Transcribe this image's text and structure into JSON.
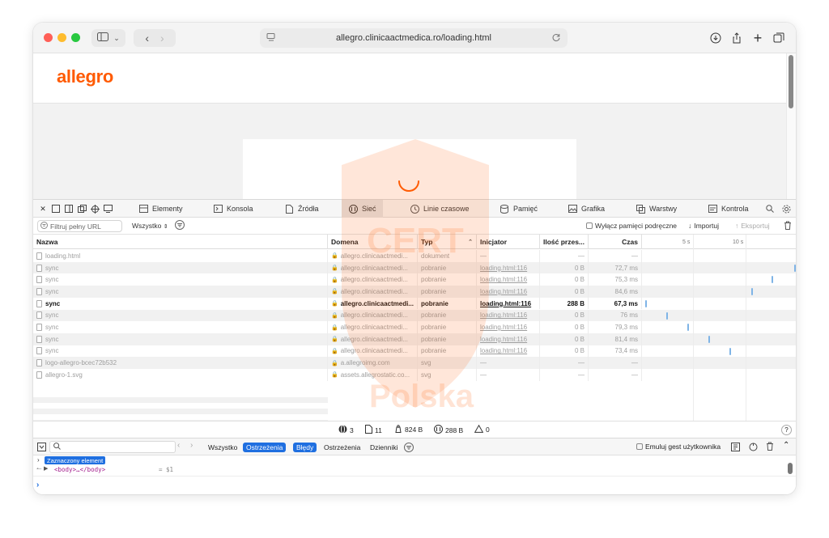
{
  "browser": {
    "url": "allegro.clinicaactmedica.ro/loading.html"
  },
  "site": {
    "logo_text": "allegro"
  },
  "devtools": {
    "tabs": [
      {
        "label": "Elementy"
      },
      {
        "label": "Konsola"
      },
      {
        "label": "Źródła"
      },
      {
        "label": "Sieć"
      },
      {
        "label": "Linie czasowe"
      },
      {
        "label": "Pamięć"
      },
      {
        "label": "Grafika"
      },
      {
        "label": "Warstwy"
      },
      {
        "label": "Kontrola"
      }
    ],
    "filter": {
      "placeholder": "Filtruj pełny URL",
      "type_select": "Wszystko",
      "disable_cache": "Wyłącz pamięci podręczne",
      "import": "Importuj",
      "export": "Eksportuj"
    },
    "columns": {
      "name": "Nazwa",
      "domain": "Domena",
      "type": "Typ",
      "initiator": "Inicjator",
      "size": "Ilość przes...",
      "time": "Czas",
      "tick_5": "5 s",
      "tick_10": "10 s"
    },
    "rows": [
      {
        "name": "loading.html",
        "domain": "allegro.clinicaactmedi...",
        "type": "dokument",
        "initiator": "—",
        "size": "—",
        "time": "—"
      },
      {
        "name": "sync",
        "domain": "allegro.clinicaactmedi...",
        "type": "pobranie",
        "initiator": "loading.html:116",
        "size": "0 B",
        "time": "72,7 ms"
      },
      {
        "name": "sync",
        "domain": "allegro.clinicaactmedi...",
        "type": "pobranie",
        "initiator": "loading.html:116",
        "size": "0 B",
        "time": "75,3 ms"
      },
      {
        "name": "sync",
        "domain": "allegro.clinicaactmedi...",
        "type": "pobranie",
        "initiator": "loading.html:116",
        "size": "0 B",
        "time": "84,6 ms"
      },
      {
        "name": "sync",
        "domain": "allegro.clinicaactmedi...",
        "type": "pobranie",
        "initiator": "loading.html:116",
        "size": "288 B",
        "time": "67,3 ms"
      },
      {
        "name": "sync",
        "domain": "allegro.clinicaactmedi...",
        "type": "pobranie",
        "initiator": "loading.html:116",
        "size": "0 B",
        "time": "76 ms"
      },
      {
        "name": "sync",
        "domain": "allegro.clinicaactmedi...",
        "type": "pobranie",
        "initiator": "loading.html:116",
        "size": "0 B",
        "time": "79,3 ms"
      },
      {
        "name": "sync",
        "domain": "allegro.clinicaactmedi...",
        "type": "pobranie",
        "initiator": "loading.html:116",
        "size": "0 B",
        "time": "81,4 ms"
      },
      {
        "name": "sync",
        "domain": "allegro.clinicaactmedi...",
        "type": "pobranie",
        "initiator": "loading.html:116",
        "size": "0 B",
        "time": "73,4 ms"
      },
      {
        "name": "logo-allegro-bcec72b532",
        "domain": "a.allegroimg.com",
        "type": "svg",
        "initiator": "—",
        "size": "—",
        "time": "—"
      },
      {
        "name": "allegro-1.svg",
        "domain": "assets.allegrostatic.co...",
        "type": "svg",
        "initiator": "—",
        "size": "—",
        "time": "—"
      }
    ],
    "status": {
      "domains": "3",
      "resources": "11",
      "transferred": "824 B",
      "size": "288 B",
      "errors": "0"
    },
    "console": {
      "filters": [
        "Wszystko",
        "Ostrzeżenia",
        "Błędy",
        "Ostrzeżenia",
        "Dzienniki"
      ],
      "filter_all": "Wszystko",
      "filter_warn_on": "Ostrzeżenia",
      "filter_errors": "Błędy",
      "filter_warnings": "Ostrzeżenia",
      "filter_logs": "Dzienniki",
      "emulate_gesture": "Emuluj gest użytkownika",
      "selected_badge": "Zaznaczony element",
      "body_code": "<body>…</body>",
      "body_eq": "= $1",
      "help": "?"
    }
  },
  "watermark": {
    "lines": [
      "CERT",
      "Polska"
    ]
  },
  "colors": {
    "brand": "#ff5a00",
    "accent": "#1f6fe0"
  }
}
